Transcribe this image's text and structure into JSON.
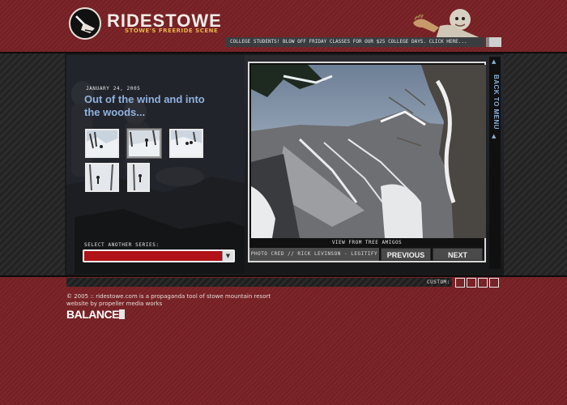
{
  "header": {
    "logo_text": "RIDESTOWE",
    "tagline": "STOWE'S FREERIDE SCENE",
    "promo_text": "COLLEGE STUDENTS! BLOW OFF FRIDAY CLASSES FOR OUR $25 COLLEGE DAYS. CLICK HERE..."
  },
  "story": {
    "date": "JANUARY 24, 2005",
    "headline": "Out of the wind and into the woods..."
  },
  "thumbnails": [
    {
      "name": "thumb-1",
      "active": false
    },
    {
      "name": "thumb-2",
      "active": true
    },
    {
      "name": "thumb-3",
      "active": false
    },
    {
      "name": "thumb-4",
      "active": false
    },
    {
      "name": "thumb-5",
      "active": false
    }
  ],
  "series": {
    "label": "SELECT ANOTHER SERIES:",
    "selected": ""
  },
  "photo": {
    "caption": "VIEW FROM TREE AMIGOS",
    "credit": "PHOTO CRED // RICK LEVINSON - LEGITIFY"
  },
  "nav": {
    "previous_label": "PREVIOUS",
    "next_label": "NEXT",
    "back_label": "BACK TO MENU"
  },
  "custom": {
    "label": "CUSTOM:",
    "swatches": [
      "#7a2226",
      "#7a2226",
      "#7a2226",
      "#7a2226"
    ]
  },
  "footer": {
    "line1": "© 2005 :: ridestowe.com is a propaganda tool of stowe mountain resort",
    "line2": "website by propeller media works",
    "partner_logo": "BALANCE"
  },
  "colors": {
    "background": "#7a2226",
    "headline": "#8fb2df",
    "select": "#b01217",
    "accent": "#e8b24a"
  }
}
